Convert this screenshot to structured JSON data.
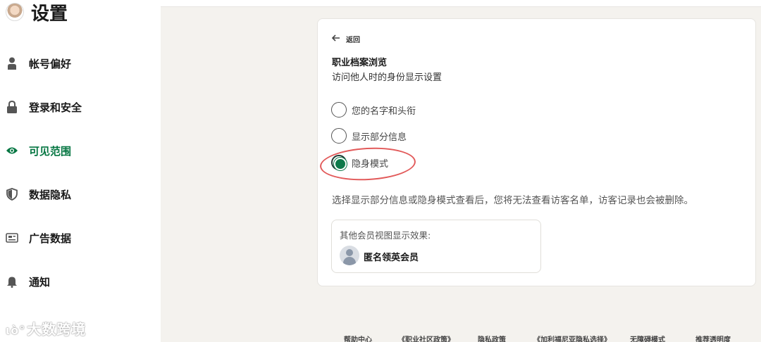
{
  "sidebar": {
    "title": "设置",
    "items": [
      {
        "label": "帐号偏好",
        "icon": "person-icon"
      },
      {
        "label": "登录和安全",
        "icon": "lock-icon"
      },
      {
        "label": "可见范围",
        "icon": "eye-icon",
        "active": true
      },
      {
        "label": "数据隐私",
        "icon": "shield-icon"
      },
      {
        "label": "广告数据",
        "icon": "ad-card-icon"
      },
      {
        "label": "通知",
        "icon": "bell-icon"
      }
    ]
  },
  "watermark": {
    "mark": "ιὸ°",
    "text": "大数跨境"
  },
  "card": {
    "back_label": "返回",
    "title": "职业档案浏览",
    "subtitle": "访问他人时的身份显示设置",
    "options": [
      {
        "label": "您的名字和头衔",
        "selected": false
      },
      {
        "label": "显示部分信息",
        "selected": false
      },
      {
        "label": "隐身模式",
        "selected": true
      }
    ],
    "note": "选择显示部分信息或隐身模式查看后，您将无法查看访客名单，访客记录也会被删除。",
    "preview": {
      "label": "其他会员视图显示效果:",
      "name": "匿名领英会员"
    }
  },
  "footer": {
    "links": [
      "帮助中心",
      "《职业社区政策》",
      "隐私政策",
      "《加利福尼亚隐私选择》",
      "无障碍模式",
      "推荐透明度"
    ]
  },
  "colors": {
    "accent_green": "#057642",
    "radio_green": "#0d7a4a",
    "highlight_red": "#e25a5a",
    "page_bg": "#f4f2ee"
  }
}
